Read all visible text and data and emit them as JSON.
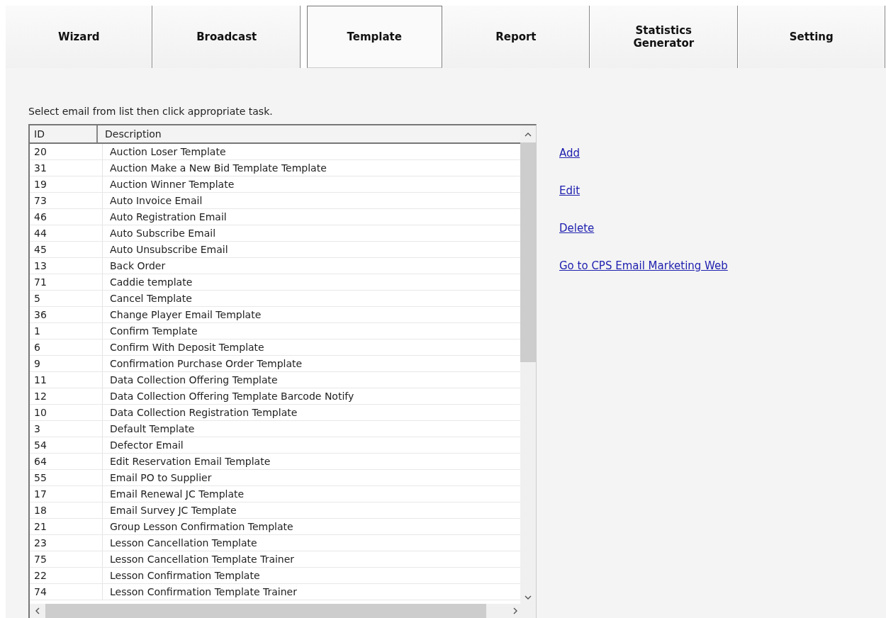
{
  "tabs": [
    {
      "label": "Wizard",
      "selected": false
    },
    {
      "label": "Broadcast",
      "selected": false
    },
    {
      "label": "Template",
      "selected": true
    },
    {
      "label": "Report",
      "selected": false
    },
    {
      "label": "Statistics Generator",
      "selected": false
    },
    {
      "label": "Setting",
      "selected": false
    }
  ],
  "instruction": "Select email from list then click appropriate task.",
  "table": {
    "columns": [
      "ID",
      "Description"
    ],
    "rows": [
      [
        "20",
        "Auction Loser Template"
      ],
      [
        "31",
        "Auction Make a New Bid Template Template"
      ],
      [
        "19",
        "Auction Winner Template"
      ],
      [
        "73",
        "Auto Invoice Email"
      ],
      [
        "46",
        "Auto Registration Email"
      ],
      [
        "44",
        "Auto Subscribe Email"
      ],
      [
        "45",
        "Auto Unsubscribe Email"
      ],
      [
        "13",
        "Back Order"
      ],
      [
        "71",
        "Caddie template"
      ],
      [
        "5",
        "Cancel Template"
      ],
      [
        "36",
        "Change Player Email Template"
      ],
      [
        "1",
        "Confirm Template"
      ],
      [
        "6",
        "Confirm With Deposit Template"
      ],
      [
        "9",
        "Confirmation Purchase Order Template"
      ],
      [
        "11",
        "Data Collection Offering Template"
      ],
      [
        "12",
        "Data Collection Offering Template Barcode Notify"
      ],
      [
        "10",
        "Data Collection Registration Template"
      ],
      [
        "3",
        "Default Template"
      ],
      [
        "54",
        "Defector Email"
      ],
      [
        "64",
        "Edit Reservation Email Template"
      ],
      [
        "55",
        "Email PO to Supplier"
      ],
      [
        "17",
        "Email Renewal JC Template"
      ],
      [
        "18",
        "Email Survey JC Template"
      ],
      [
        "21",
        "Group Lesson Confirmation Template"
      ],
      [
        "23",
        "Lesson Cancellation Template"
      ],
      [
        "75",
        "Lesson Cancellation Template Trainer"
      ],
      [
        "22",
        "Lesson Confirmation Template"
      ],
      [
        "74",
        "Lesson Confirmation Template Trainer"
      ]
    ]
  },
  "actions": [
    "Add",
    "Edit",
    "Delete",
    "Go to CPS Email Marketing Web"
  ]
}
